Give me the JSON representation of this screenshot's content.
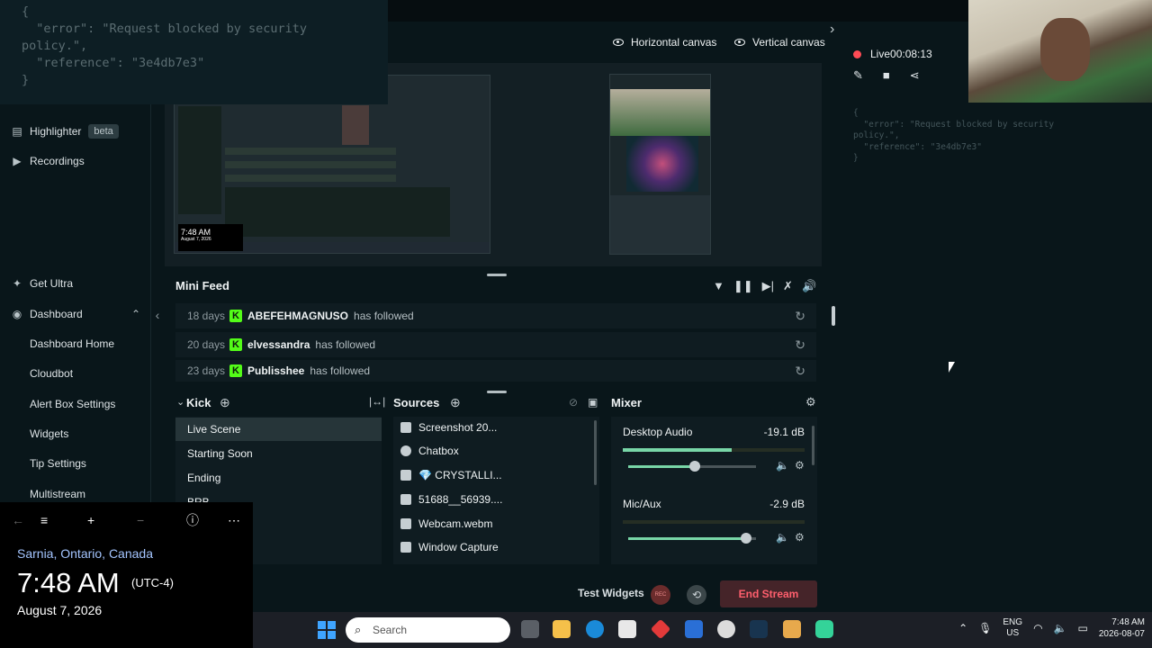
{
  "error_overlay": {
    "text": "{\n  \"error\": \"Request blocked by security\npolicy.\",\n  \"reference\": \"3e4db7e3\"\n}"
  },
  "side_error": {
    "text": "{\n  \"error\": \"Request blocked by security\npolicy.\",\n  \"reference\": \"3e4db7e3\"\n}"
  },
  "sidebar": {
    "highlighter": "Highlighter",
    "beta": "beta",
    "recordings": "Recordings",
    "get_ultra": "Get Ultra",
    "dashboard": "Dashboard",
    "dashboard_items": [
      "Dashboard Home",
      "Cloudbot",
      "Alert Box Settings",
      "Widgets",
      "Tip Settings",
      "Multistream"
    ]
  },
  "canvas": {
    "horizontal": "Horizontal canvas",
    "vertical": "Vertical canvas"
  },
  "preview": {
    "clock_time": "7:48 AM",
    "clock_date": "August 7, 2026"
  },
  "mini_feed": {
    "title": "Mini Feed",
    "rows": [
      {
        "age": "18 days",
        "user": "ABEFEHMAGNUSO",
        "action": "has followed"
      },
      {
        "age": "20 days",
        "user": "elvessandra",
        "action": "has followed"
      },
      {
        "age": "23 days",
        "user": "Publisshee",
        "action": "has followed"
      }
    ]
  },
  "scenes": {
    "title": "Kick",
    "items": [
      "Live Scene",
      "Starting Soon",
      "Ending",
      "BRB"
    ],
    "active": "Live Scene"
  },
  "sources": {
    "title": "Sources",
    "items": [
      "Screenshot 20...",
      "Chatbox",
      "💎 CRYSTALLI...",
      "51688__56939....",
      "Webcam.webm",
      "Window Capture"
    ]
  },
  "mixer": {
    "title": "Mixer",
    "channels": [
      {
        "name": "Desktop Audio",
        "db": "-19.1 dB",
        "meter_level": 0.6,
        "volume": 0.52
      },
      {
        "name": "Mic/Aux",
        "db": "-2.9 dB",
        "meter_level": 0.0,
        "volume": 0.92
      }
    ]
  },
  "bottom": {
    "test_widgets": "Test Widgets",
    "rec": "REC",
    "end_stream": "End Stream"
  },
  "live": {
    "status": "Live",
    "time": "00:08:13"
  },
  "clock_window": {
    "location": "Sarnia, Ontario, Canada",
    "time": "7:48 AM",
    "tz": "(UTC-4)",
    "date": "August 7, 2026"
  },
  "taskbar": {
    "search": "Search",
    "lang_top": "ENG",
    "lang_bottom": "US",
    "time": "7:48 AM",
    "date": "2026-08-07"
  },
  "colors": {
    "accent": "#78d6a7",
    "live": "#ff4b55",
    "end_stream": "#ff5f6d",
    "kick": "#53fc18"
  }
}
